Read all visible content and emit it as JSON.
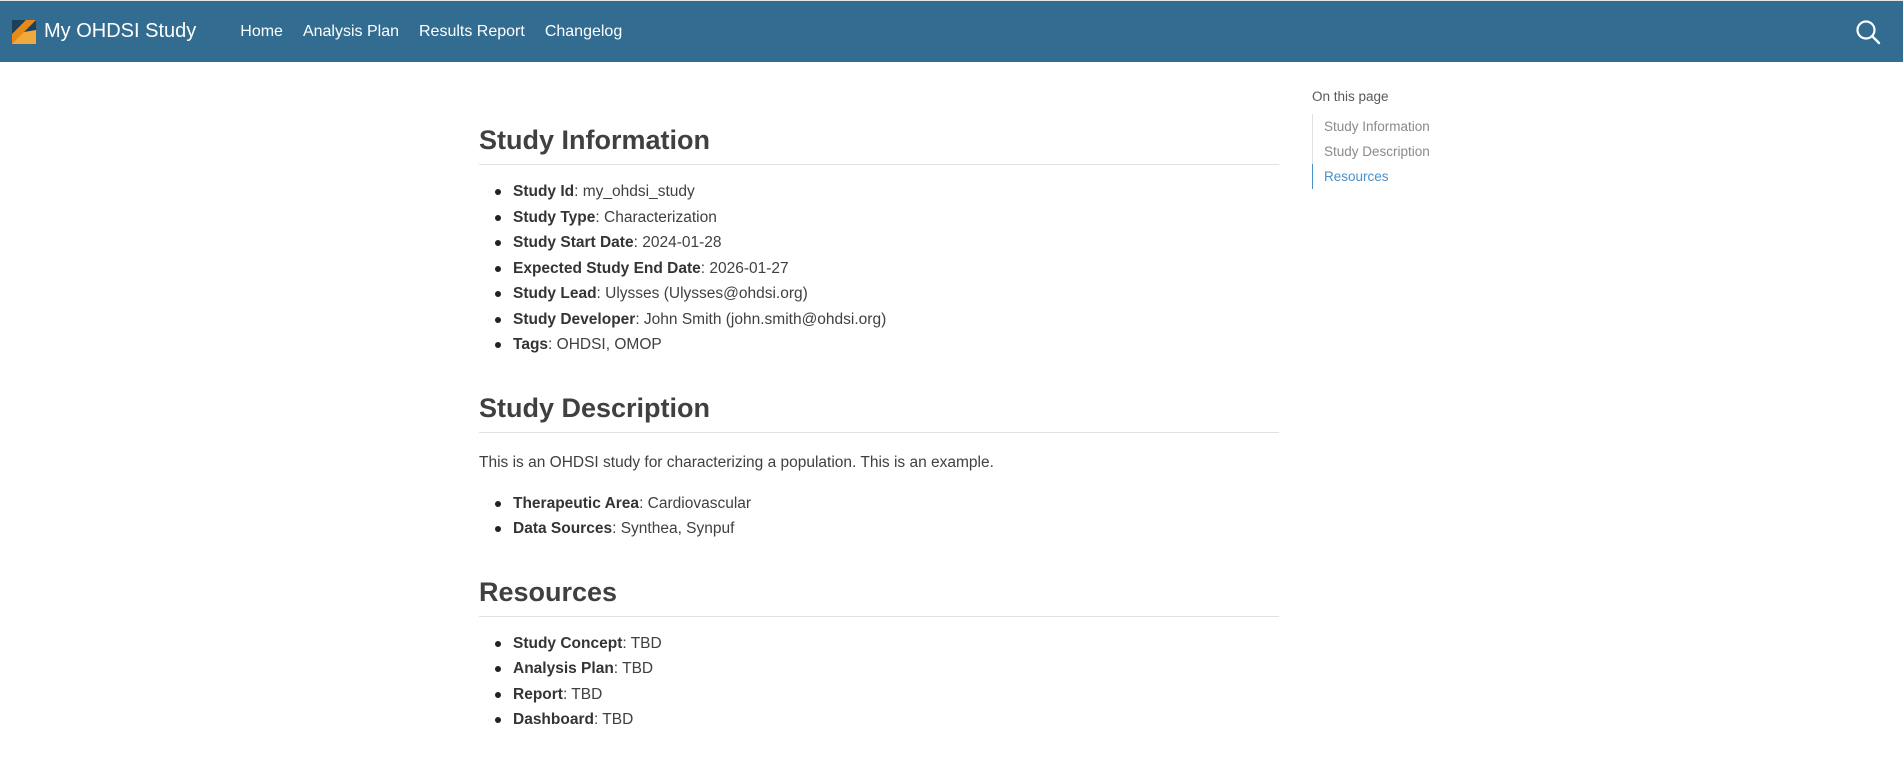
{
  "navbar": {
    "brand_title": "My OHDSI Study",
    "links": [
      {
        "label": "Home"
      },
      {
        "label": "Analysis Plan"
      },
      {
        "label": "Results Report"
      },
      {
        "label": "Changelog"
      }
    ],
    "search_icon": "search-icon",
    "colors": {
      "background": "#336c91",
      "text": "#ffffff"
    }
  },
  "main": {
    "study_information": {
      "title": "Study Information",
      "items": [
        {
          "key": "Study Id",
          "value": ": my_ohdsi_study"
        },
        {
          "key": "Study Type",
          "value": ": Characterization"
        },
        {
          "key": "Study Start Date",
          "value": ": 2024-01-28"
        },
        {
          "key": "Expected Study End Date",
          "value": ": 2026-01-27"
        },
        {
          "key": "Study Lead",
          "value": ": Ulysses (Ulysses@ohdsi.org)"
        },
        {
          "key": "Study Developer",
          "value": ": John Smith (john.smith@ohdsi.org)"
        },
        {
          "key": "Tags",
          "value": ": OHDSI, OMOP"
        }
      ]
    },
    "study_description": {
      "title": "Study Description",
      "paragraph": "This is an OHDSI study for characterizing a population. This is an example.",
      "items": [
        {
          "key": "Therapeutic Area",
          "value": ": Cardiovascular"
        },
        {
          "key": "Data Sources",
          "value": ": Synthea, Synpuf"
        }
      ]
    },
    "resources": {
      "title": "Resources",
      "items": [
        {
          "key": "Study Concept",
          "value": ": TBD"
        },
        {
          "key": "Analysis Plan",
          "value": ": TBD"
        },
        {
          "key": "Report",
          "value": ": TBD"
        },
        {
          "key": "Dashboard",
          "value": ": TBD"
        }
      ]
    }
  },
  "toc": {
    "title": "On this page",
    "items": [
      {
        "label": "Study Information"
      },
      {
        "label": "Study Description"
      },
      {
        "label": "Resources"
      }
    ],
    "active_color": "#4a90c9"
  }
}
